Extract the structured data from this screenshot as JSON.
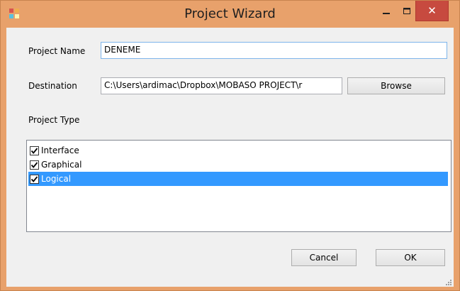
{
  "window": {
    "title": "Project Wizard",
    "minimize_glyph": "–",
    "maximize_glyph": "□",
    "close_glyph": "✕"
  },
  "form": {
    "project_name_label": "Project Name",
    "project_name_value": "DENEME",
    "destination_label": "Destination",
    "destination_value": "C:\\Users\\ardimac\\Dropbox\\MOBASO PROJECT\\r",
    "browse_label": "Browse",
    "project_type_label": "Project Type"
  },
  "project_types": [
    {
      "label": "Interface",
      "checked": true,
      "selected": false
    },
    {
      "label": "Graphical",
      "checked": true,
      "selected": false
    },
    {
      "label": "Logical",
      "checked": true,
      "selected": true
    }
  ],
  "footer": {
    "cancel_label": "Cancel",
    "ok_label": "OK"
  },
  "colors": {
    "titlebar": "#e8a16b",
    "close_button": "#c74a3f",
    "selection": "#3399ff",
    "focus_border": "#7eb4ea"
  }
}
